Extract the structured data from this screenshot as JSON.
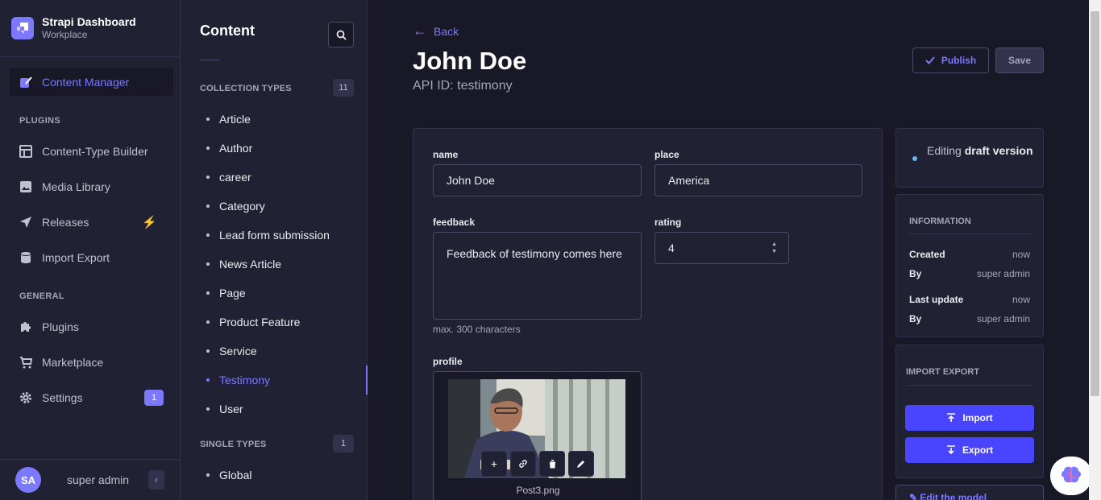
{
  "brand": {
    "title": "Strapi Dashboard",
    "subtitle": "Workplace"
  },
  "nav": {
    "content_manager": "Content Manager",
    "plugins_section": "PLUGINS",
    "content_type_builder": "Content-Type Builder",
    "media_library": "Media Library",
    "releases": "Releases",
    "import_export": "Import Export",
    "general_section": "GENERAL",
    "plugins": "Plugins",
    "marketplace": "Marketplace",
    "settings": "Settings",
    "settings_badge": "1"
  },
  "user": {
    "initials": "SA",
    "name": "super admin"
  },
  "subnav": {
    "title": "Content",
    "collection_types_label": "COLLECTION TYPES",
    "collection_types_count": "11",
    "collection_types": [
      "Article",
      "Author",
      "career",
      "Category",
      "Lead form submission",
      "News Article",
      "Page",
      "Product Feature",
      "Service",
      "Testimony",
      "User"
    ],
    "active_item": "Testimony",
    "single_types_label": "SINGLE TYPES",
    "single_types_count": "1",
    "single_types": [
      "Global"
    ]
  },
  "header": {
    "back": "Back",
    "title": "John Doe",
    "api_id": "API ID: testimony",
    "publish": "Publish",
    "save": "Save"
  },
  "form": {
    "name_label": "name",
    "name_value": "John Doe",
    "place_label": "place",
    "place_value": "America",
    "feedback_label": "feedback",
    "feedback_value": "Feedback of testimony comes here",
    "feedback_hint": "max. 300 characters",
    "rating_label": "rating",
    "rating_value": "4",
    "profile_label": "profile",
    "profile_file": "Post3.png"
  },
  "status": {
    "prefix": "Editing",
    "bold": "draft version"
  },
  "information": {
    "heading": "INFORMATION",
    "created_label": "Created",
    "created_value": "now",
    "created_by_label": "By",
    "created_by_value": "super admin",
    "updated_label": "Last update",
    "updated_value": "now",
    "updated_by_label": "By",
    "updated_by_value": "super admin"
  },
  "import_export": {
    "heading": "IMPORT EXPORT",
    "import": "Import",
    "export": "Export"
  },
  "edit_model": "Edit the model",
  "colors": {
    "accent": "#7b79ff",
    "primary_button": "#4945ff",
    "background": "#181826",
    "panel": "#212134"
  }
}
